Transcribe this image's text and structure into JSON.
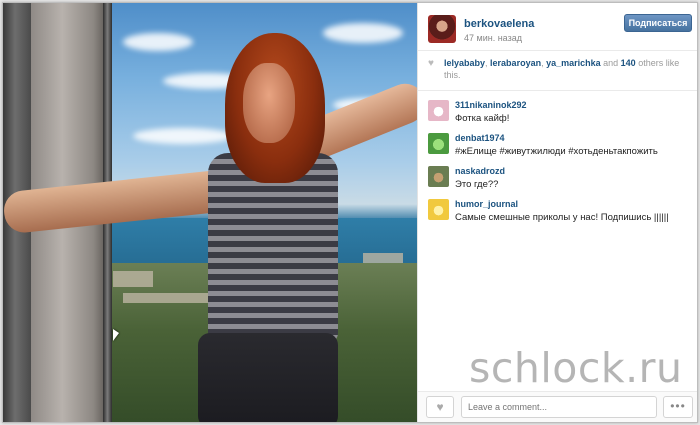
{
  "post": {
    "username": "berkovaelena",
    "time_ago": "47 мин. назад",
    "follow_label": "Подписаться"
  },
  "likes": {
    "users": [
      "lelyababy",
      "lerabaroyan",
      "ya_marichka"
    ],
    "separator": ", ",
    "and_text": " and ",
    "others_count": "140",
    "others_text": " others like this."
  },
  "comments": [
    {
      "user": "311nikaninok292",
      "text": "Фотка кайф!",
      "avatar_color": "#e6b7c7"
    },
    {
      "user": "denbat1974",
      "text": "#жЕлище #живутжилюди #хотьденьтакпожить",
      "avatar_color": "#4b9a3f"
    },
    {
      "user": "naskadrozd",
      "text": "Это где??",
      "avatar_color": "#6a7d52"
    },
    {
      "user": "humor_journal",
      "text": "Самые смешные приколы у нас! Подпишись ||||||",
      "avatar_color": "#f1c93e"
    }
  ],
  "footer": {
    "comment_placeholder": "Leave a comment...",
    "more_label": "•••"
  },
  "watermark": "schlock.ru",
  "icons": {
    "heart": "heart-icon",
    "more": "more-icon"
  }
}
